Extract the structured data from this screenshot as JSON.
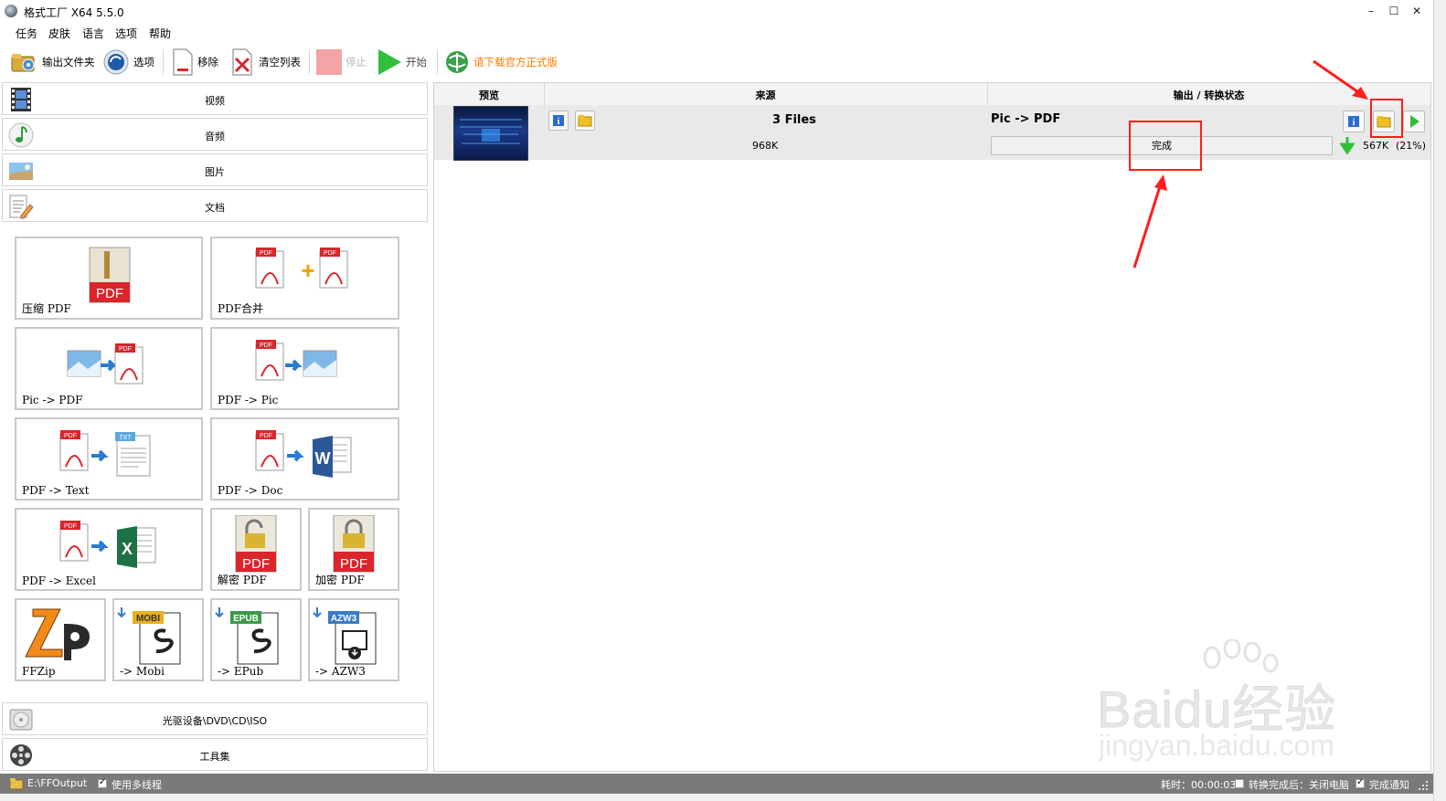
{
  "window": {
    "title": "格式工厂 X64 5.5.0",
    "minimize_glyph": "–",
    "maximize_glyph": "☐",
    "close_glyph": "✕"
  },
  "menu": {
    "items": [
      {
        "label": "任务"
      },
      {
        "label": "皮肤"
      },
      {
        "label": "语言"
      },
      {
        "label": "选项"
      },
      {
        "label": "帮助"
      }
    ]
  },
  "toolbar": {
    "output_folder_label": "输出文件夹",
    "options_label": "选项",
    "remove_label": "移除",
    "clear_list_label": "清空列表",
    "stop_label": "停止",
    "start_label": "开始",
    "download_label": "请下载官方正式版",
    "download_color": "#ff7a00"
  },
  "sidebar": {
    "categories_top": [
      {
        "label": "视频",
        "icon": "film-icon"
      },
      {
        "label": "音频",
        "icon": "music-note-icon"
      },
      {
        "label": "图片",
        "icon": "landscape-picture-icon"
      },
      {
        "label": "文档",
        "icon": "document-pen-icon"
      }
    ],
    "tiles": [
      {
        "label": "压缩 PDF",
        "icon": "compress-pdf-icon"
      },
      {
        "label": "PDF合并",
        "icon": "pdf-merge-icon"
      },
      {
        "label": "Pic -> PDF",
        "icon": "pic-to-pdf-icon"
      },
      {
        "label": "PDF -> Pic",
        "icon": "pdf-to-pic-icon"
      },
      {
        "label": "PDF -> Text",
        "icon": "pdf-to-text-icon"
      },
      {
        "label": "PDF -> Doc",
        "icon": "pdf-to-word-icon"
      },
      {
        "label": "PDF -> Excel",
        "icon": "pdf-to-excel-icon"
      },
      {
        "label": "解密 PDF",
        "icon": "unlock-pdf-icon"
      },
      {
        "label": "加密 PDF",
        "icon": "lock-pdf-icon"
      },
      {
        "label": "FFZip",
        "icon": "ffzip-icon"
      },
      {
        "label": "-> Mobi",
        "icon": "mobi-icon",
        "badge": "MOBI"
      },
      {
        "label": "-> EPub",
        "icon": "epub-icon",
        "badge": "EPUB"
      },
      {
        "label": "-> AZW3",
        "icon": "azw3-icon",
        "badge": "AZW3"
      }
    ],
    "categories_bottom": [
      {
        "label": "光驱设备\\DVD\\CD\\ISO",
        "icon": "disc-drive-icon"
      },
      {
        "label": "工具集",
        "icon": "film-reel-tools-icon"
      }
    ],
    "small_text": {
      "pdf": "PDF",
      "txt": "TXT",
      "w": "W",
      "x": "X",
      "plus": "+"
    }
  },
  "task_list": {
    "columns": [
      "预览",
      "来源",
      "输出 / 转换状态"
    ],
    "rows": [
      {
        "source_title": "3 Files",
        "source_size": "968K",
        "output_type": "Pic -> PDF",
        "status": "完成",
        "progress": 1.0,
        "output_size": "567K",
        "ratio": "(21%)"
      }
    ]
  },
  "statusbar": {
    "output_path": "E:\\FFOutput",
    "multithread_label": "使用多线程",
    "multithread_checked": true,
    "elapsed_label": "耗时：00:00:03",
    "after_convert_label": "转换完成后：关闭电脑",
    "after_convert_checked": false,
    "notify_label": "完成通知",
    "notify_checked": true
  },
  "watermark": {
    "brand": "Baidu经验",
    "url": "jingyan.baidu.com"
  },
  "colors": {
    "annotation_red": "#ff1d1d",
    "pdf_red": "#d9262c",
    "start_green": "#2fbf3a",
    "status_gray": "#7a7a7a"
  }
}
